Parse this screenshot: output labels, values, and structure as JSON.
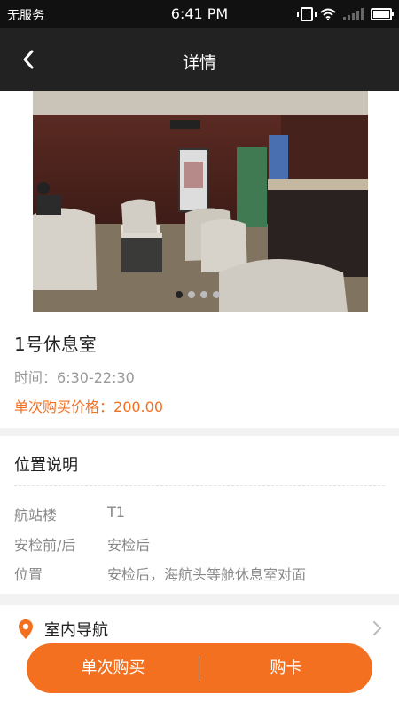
{
  "status_bar": {
    "carrier": "无服务",
    "time": "6:41 PM"
  },
  "header": {
    "title": "详情"
  },
  "gallery": {
    "page_count": 4,
    "active_index": 0
  },
  "lounge": {
    "name": "1号休息室",
    "time_label": "时间：",
    "time_value": "6:30-22:30",
    "price_label": "单次购买价格：",
    "price_value": "200.00"
  },
  "location": {
    "title": "位置说明",
    "rows": [
      {
        "key": "航站楼",
        "value": "T1"
      },
      {
        "key": "安检前/后",
        "value": "安检后"
      },
      {
        "key": "位置",
        "value": "安检后，海航头等舱休息室对面"
      }
    ]
  },
  "indoor_nav": {
    "label": "室内导航"
  },
  "actions": {
    "single_buy": "单次购买",
    "buy_card": "购卡"
  },
  "colors": {
    "accent": "#f37021",
    "header_bg": "#222222"
  }
}
